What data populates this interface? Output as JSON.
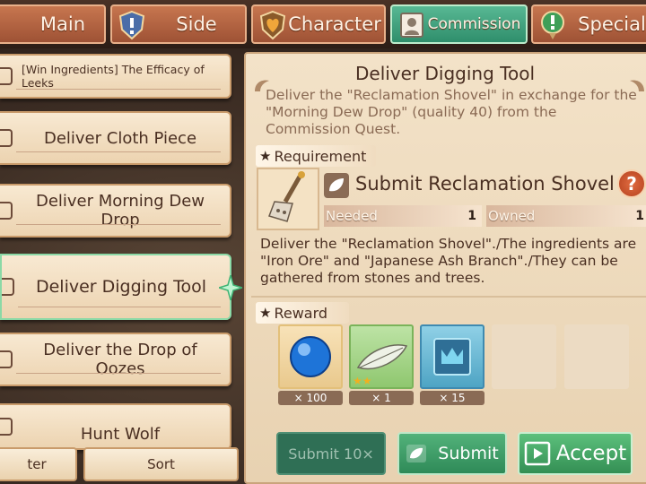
{
  "tabs": [
    {
      "label": "Main",
      "icon": "sword-icon"
    },
    {
      "label": "Side",
      "icon": "shield-exclaim-icon"
    },
    {
      "label": "Character",
      "icon": "heart-shield-icon"
    },
    {
      "label": "Commission",
      "icon": "portrait-icon",
      "active": true
    },
    {
      "label": "Special",
      "icon": "exclaim-badge-icon"
    }
  ],
  "quest_list": [
    {
      "label": "[Win Ingredients] The Efficacy of Leeks"
    },
    {
      "label": "Deliver Cloth Piece"
    },
    {
      "label": "Deliver Morning Dew Drop"
    },
    {
      "label": "Deliver Digging Tool",
      "selected": true
    },
    {
      "label": "Deliver the Drop of Oozes"
    },
    {
      "label": "Hunt Wolf"
    }
  ],
  "bottom_left": {
    "filter_label": "ter",
    "sort_label": "Sort"
  },
  "detail": {
    "title": "Deliver Digging Tool",
    "description": "Deliver the \"Reclamation Shovel\" in exchange for the \"Morning Dew Drop\" (quality 40) from the Commission Quest.",
    "requirement_heading": "Requirement",
    "requirement_title": "Submit Reclamation Shovel",
    "needed_label": "Needed",
    "needed_value": "1",
    "owned_label": "Owned",
    "owned_value": "1",
    "requirement_text": "Deliver the \"Reclamation Shovel\"./The ingredients are \"Iron Ore\" and \"Japanese Ash Branch\"./They can be gathered from stones and trees.",
    "help_label": "?",
    "reward_heading": "Reward",
    "rewards": [
      {
        "icon": "blue-orb-icon",
        "qty": "× 100"
      },
      {
        "icon": "leaf-feather-icon",
        "qty": "× 1",
        "stars": "★★"
      },
      {
        "icon": "crown-badge-icon",
        "qty": "× 15"
      }
    ]
  },
  "actions": {
    "submit10_label": "Submit 10×",
    "submit_label": "Submit",
    "accept_label": "Accept"
  },
  "colors": {
    "active_tab": "#3f9f7c",
    "tab": "#b3603e",
    "accept": "#3f9f58"
  }
}
